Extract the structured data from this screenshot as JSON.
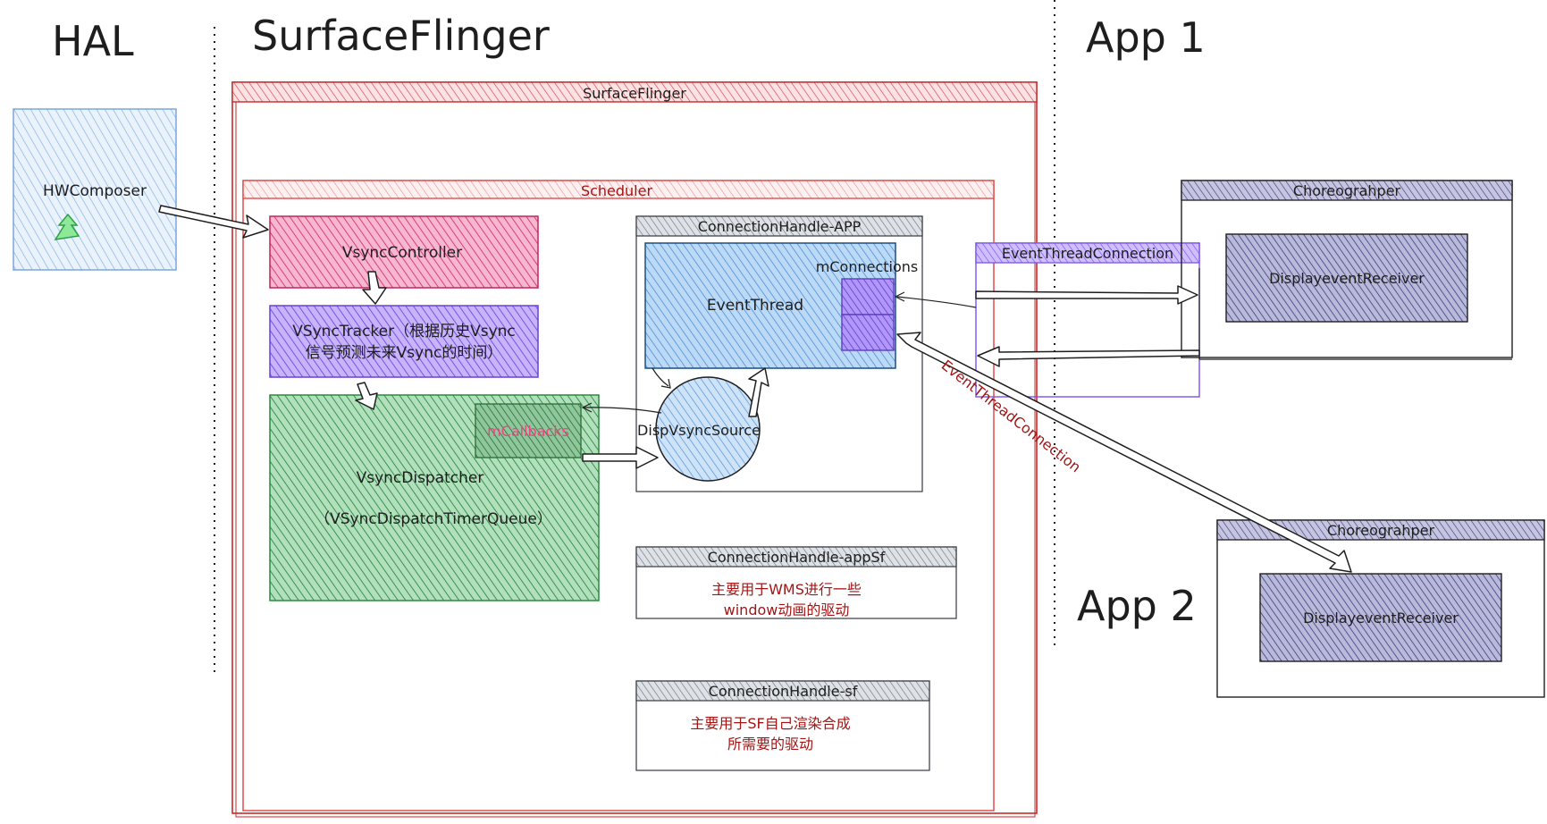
{
  "headings": {
    "hal": "HAL",
    "surfaceflinger": "SurfaceFlinger",
    "app1": "App 1",
    "app2": "App 2"
  },
  "boxes": {
    "hwcomposer": "HWComposer",
    "sf_container": "SurfaceFlinger",
    "scheduler": "Scheduler",
    "vsync_controller": "VsyncController",
    "vsync_tracker_line1": "VSyncTracker（根据历史Vsync",
    "vsync_tracker_line2": "信号预测未来Vsync的时间）",
    "vsync_dispatcher": "VsyncDispatcher",
    "vsync_dispatcher_sub": "（VSyncDispatchTimerQueue）",
    "mcallbacks": "mCallbacks",
    "connection_app": "ConnectionHandle-APP",
    "event_thread": "EventThread",
    "mconnections": "mConnections",
    "disp_vsync_source": "DispVsyncSource",
    "connection_appsf": "ConnectionHandle-appSf",
    "appsf_desc_line1": "主要用于WMS进行一些",
    "appsf_desc_line2": "window动画的驱动",
    "connection_sf": "ConnectionHandle-sf",
    "sf_desc_line1": "主要用于SF自己渲染合成",
    "sf_desc_line2": "所需要的驱动",
    "event_thread_connection": "EventThreadConnection",
    "choreographer1": "Choreograhper",
    "display_receiver1": "DisplayeventReceiver",
    "choreographer2": "Choreograhper",
    "display_receiver2": "DisplayeventReceiver",
    "event_thread_connection_diag": "EventThreadConnection"
  },
  "colors": {
    "hal_blue": "#a5c8ec",
    "sf_red": "#c92a2a",
    "scheduler_red": "#e03131",
    "controller_pink": "#e64980",
    "tracker_purple": "#7950f2",
    "dispatcher_green": "#2f9e44",
    "eventthread_blue": "#74b0e8",
    "receiver_navy": "#4c4c9a",
    "header_gray": "#868e96"
  }
}
